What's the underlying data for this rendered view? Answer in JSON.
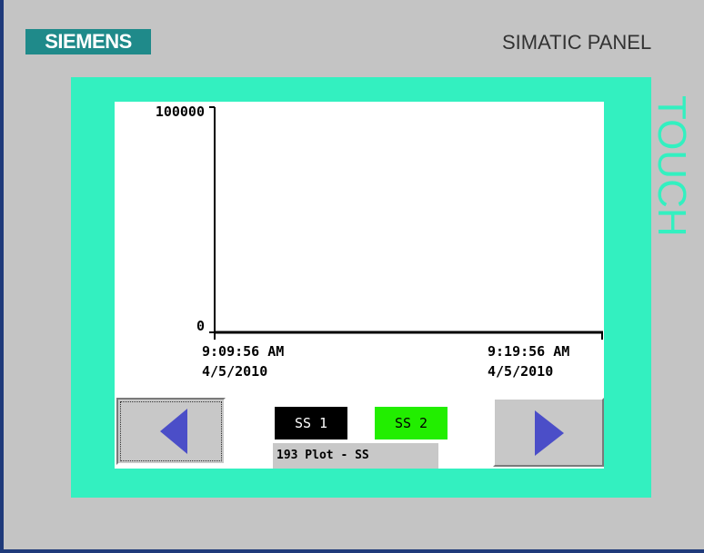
{
  "header": {
    "brand": "SIEMENS",
    "panel_label": "SIMATIC PANEL",
    "touch_label": "TOUCH"
  },
  "trend": {
    "y_max_label": "100000",
    "y_min_label": "0",
    "x_start_time": "9:09:56 AM",
    "x_start_date": "4/5/2010",
    "x_end_time": "9:19:56 AM",
    "x_end_date": "4/5/2010"
  },
  "legend": [
    {
      "label": "SS 1",
      "bg": "#000000",
      "fg": "#ffffff"
    },
    {
      "label": "SS 2",
      "bg": "#22ee00",
      "fg": "#000000"
    }
  ],
  "plot_name": "193 Plot - SS",
  "nav": {
    "prev_icon": "triangle-left-icon",
    "next_icon": "triangle-right-icon",
    "arrow_color": "#4b4ec8"
  },
  "colors": {
    "brand": "#1f8a8a",
    "frame": "#33f0c0",
    "bezel": "#c4c4c4"
  }
}
